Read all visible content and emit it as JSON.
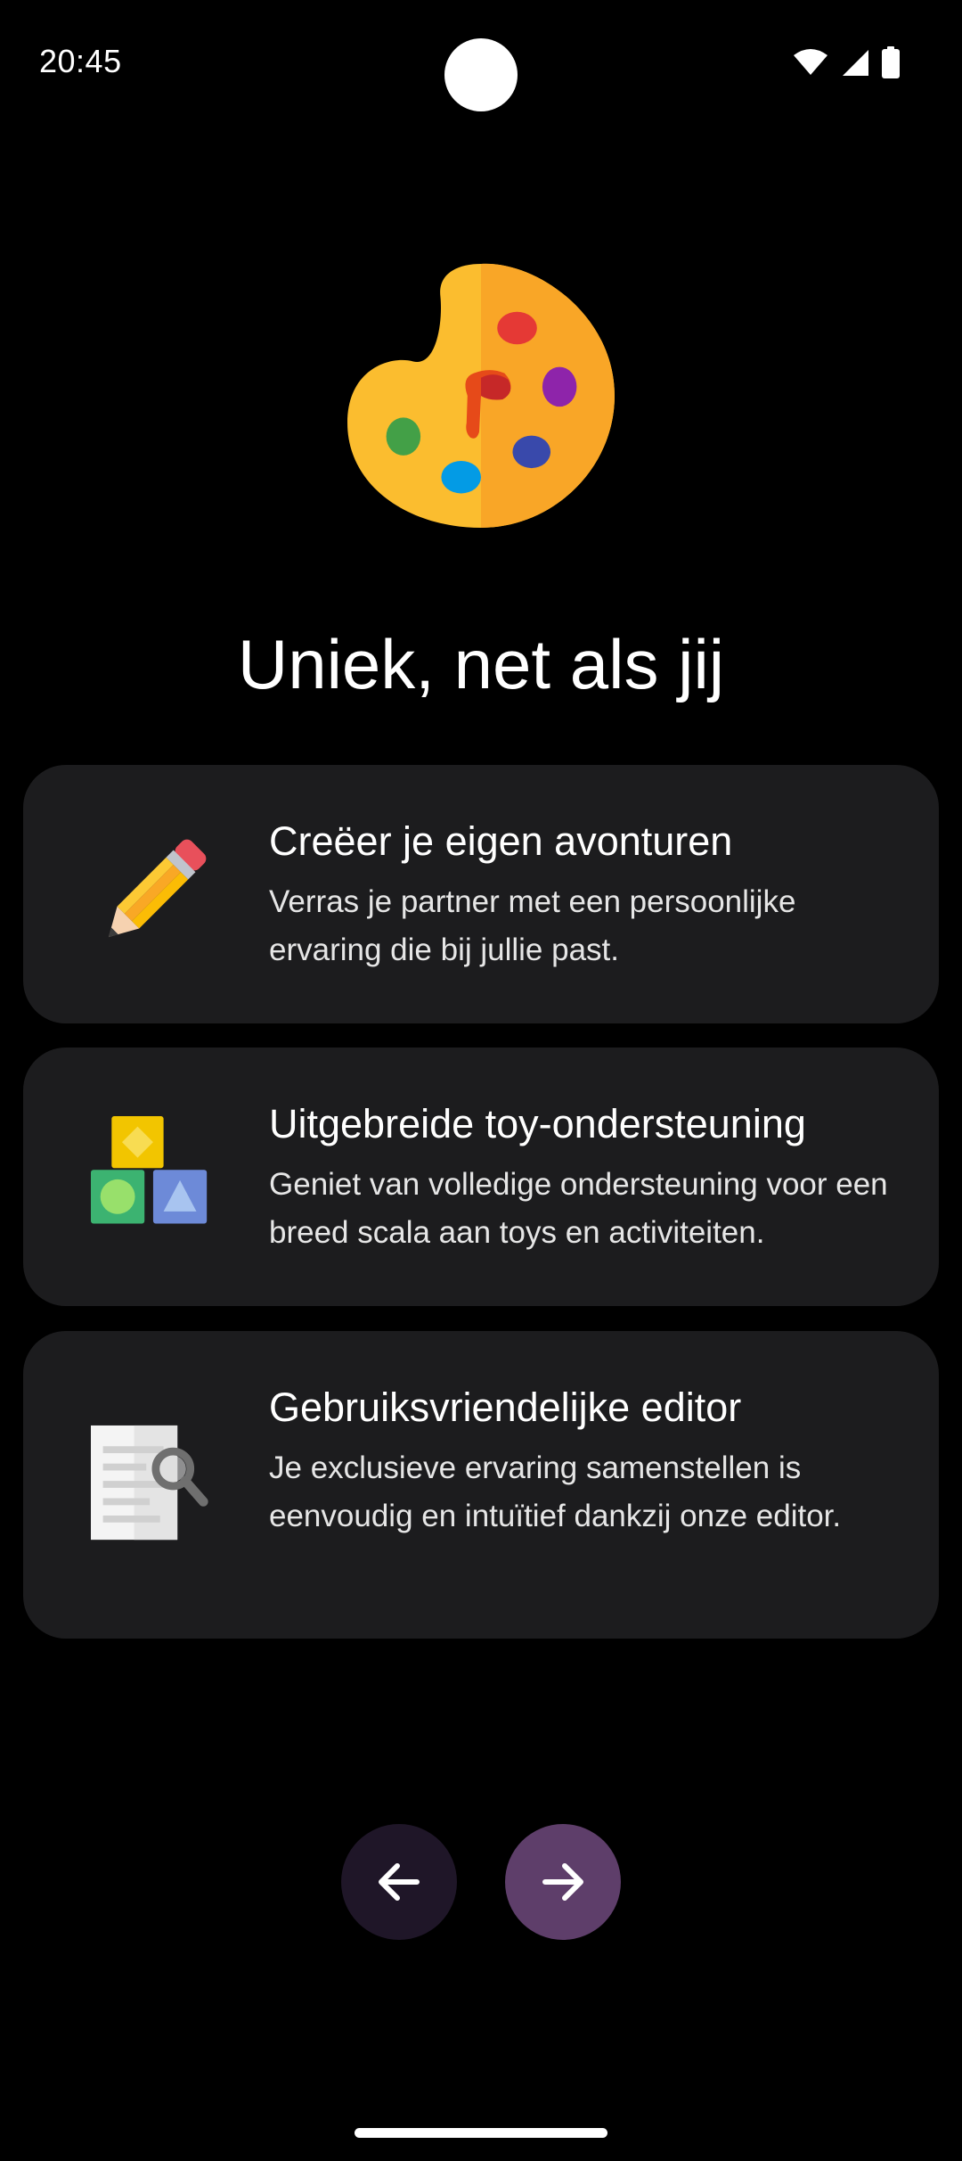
{
  "status_bar": {
    "time": "20:45"
  },
  "page": {
    "title": "Uniek, net als jij"
  },
  "features": [
    {
      "title": "Creëer je eigen avonturen",
      "description": "Verras je partner met een persoonlijke ervaring die bij jullie past.",
      "icon": "pencil-icon"
    },
    {
      "title": "Uitgebreide toy-ondersteuning",
      "description": "Geniet van volledige ondersteuning voor een breed scala aan toys en activiteiten.",
      "icon": "shapes-blocks-icon"
    },
    {
      "title": "Gebruiksvriendelijke editor",
      "description": "Je exclusieve ervaring samenstellen is eenvoudig en intuïtief dankzij onze editor.",
      "icon": "document-search-icon"
    }
  ],
  "navigation": {
    "back_icon": "arrow-left-icon",
    "next_icon": "arrow-right-icon"
  },
  "colors": {
    "background": "#000000",
    "card": "#1c1c1e",
    "back_button": "#1f1628",
    "next_button": "#5e3e6a"
  }
}
